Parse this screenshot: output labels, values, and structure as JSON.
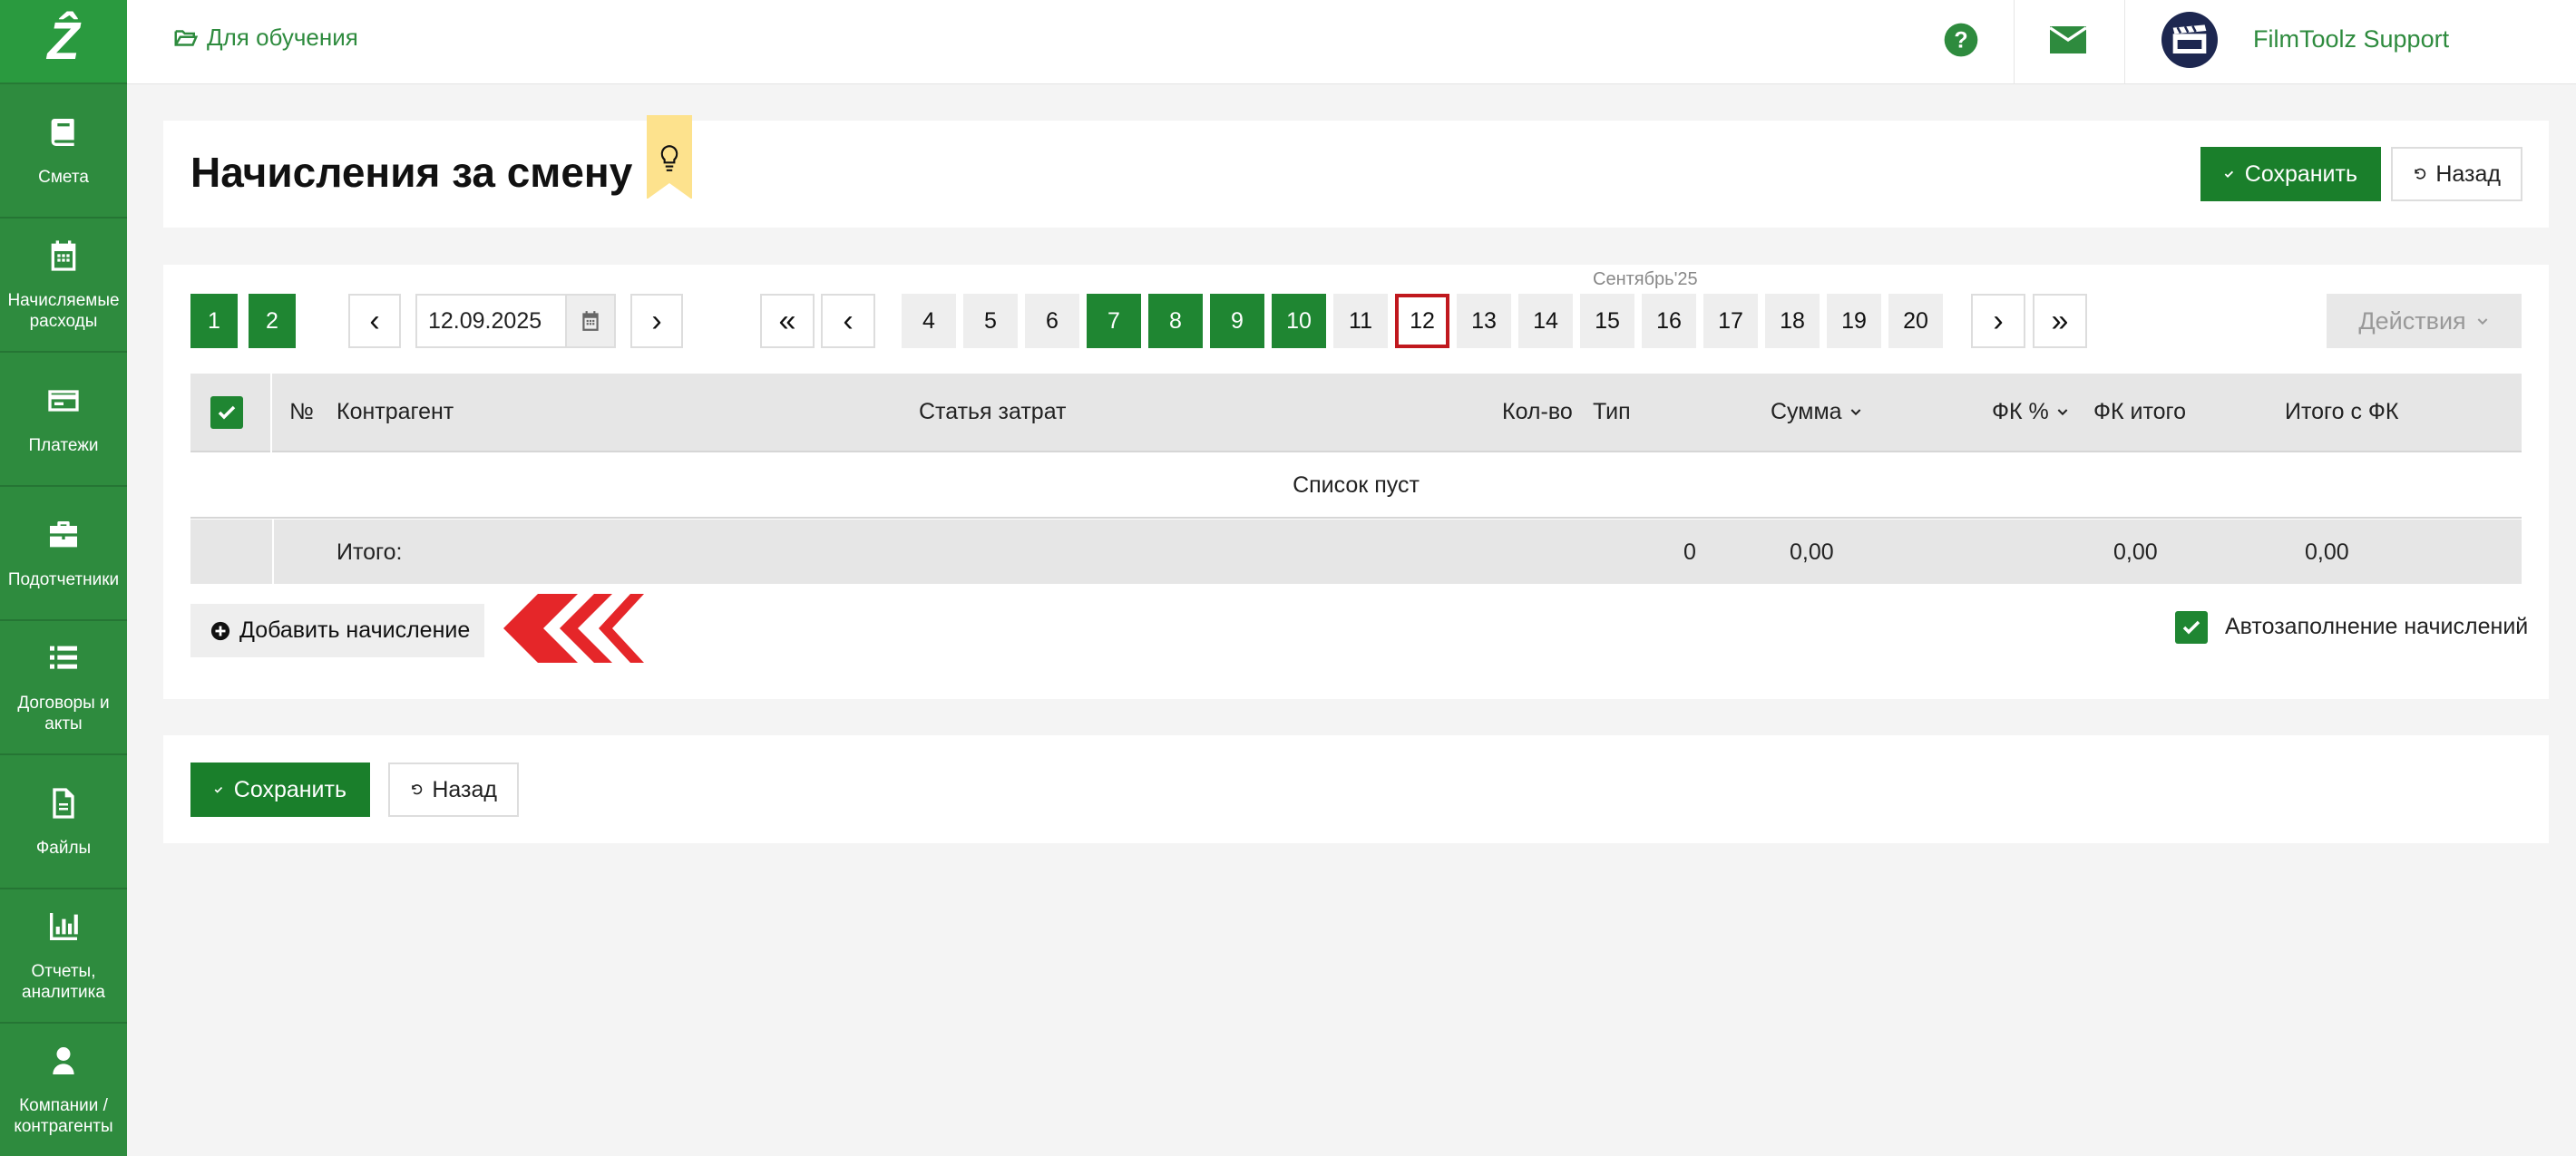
{
  "app": {
    "logo": "Ẑ"
  },
  "sidebar": {
    "items": [
      {
        "icon": "book-icon",
        "label": "Смета"
      },
      {
        "icon": "calendar-icon",
        "label": "Начисляемые расходы"
      },
      {
        "icon": "credit-card-icon",
        "label": "Платежи"
      },
      {
        "icon": "briefcase-icon",
        "label": "Подотчетники"
      },
      {
        "icon": "list-icon",
        "label": "Договоры и акты"
      },
      {
        "icon": "file-icon",
        "label": "Файлы"
      },
      {
        "icon": "bar-chart-icon",
        "label": "Отчеты, аналитика"
      },
      {
        "icon": "user-icon",
        "label": "Компании / контрагенты"
      }
    ]
  },
  "topbar": {
    "breadcrumb": "Для обучения",
    "user_name": "FilmToolz Support",
    "language": "RU"
  },
  "header": {
    "title": "Начисления за смену",
    "save_label": "Сохранить",
    "back_label": "Назад"
  },
  "nav": {
    "shift_tabs": [
      "1",
      "2"
    ],
    "prev_label": "‹",
    "next_label": "›",
    "first_label": "«",
    "last_label": "»",
    "date_value": "12.09.2025",
    "month_label": "Сентябрь'25",
    "days": [
      {
        "n": "4",
        "state": "empty"
      },
      {
        "n": "5",
        "state": "empty"
      },
      {
        "n": "6",
        "state": "empty"
      },
      {
        "n": "7",
        "state": "filled"
      },
      {
        "n": "8",
        "state": "filled"
      },
      {
        "n": "9",
        "state": "filled"
      },
      {
        "n": "10",
        "state": "filled"
      },
      {
        "n": "11",
        "state": "empty"
      },
      {
        "n": "12",
        "state": "selected"
      },
      {
        "n": "13",
        "state": "empty"
      },
      {
        "n": "14",
        "state": "empty"
      },
      {
        "n": "15",
        "state": "empty"
      },
      {
        "n": "16",
        "state": "empty"
      },
      {
        "n": "17",
        "state": "empty"
      },
      {
        "n": "18",
        "state": "empty"
      },
      {
        "n": "19",
        "state": "empty"
      },
      {
        "n": "20",
        "state": "empty"
      }
    ],
    "actions_label": "Действия"
  },
  "table": {
    "columns": {
      "num": "№",
      "contractor": "Контрагент",
      "expense": "Статья затрат",
      "qty": "Кол-во",
      "type": "Тип",
      "sum": "Сумма",
      "fk_pct": "ФК %",
      "fk_total": "ФК итого",
      "total_fk": "Итого с ФК"
    },
    "empty_text": "Список пуст",
    "footer": {
      "label": "Итого:",
      "qty": "0",
      "sum": "0,00",
      "fk_total": "0,00",
      "total_fk": "0,00"
    }
  },
  "footer_actions": {
    "add_label": "Добавить начисление",
    "autofill_label": "Автозаполнение начислений",
    "autofill_checked": true,
    "save_label": "Сохранить",
    "back_label": "Назад"
  },
  "colors": {
    "brand_green": "#2e8b3e",
    "button_green": "#1a7f2b",
    "selected_border": "#c0181e",
    "arrow_red": "#e52629",
    "bookmark_yellow": "#fde28d"
  }
}
